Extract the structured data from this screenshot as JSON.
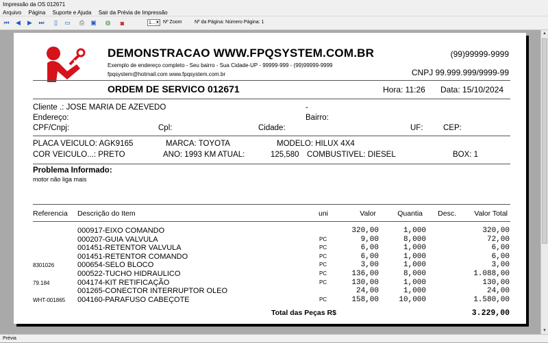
{
  "window": {
    "title": "Impressão da OS 012671"
  },
  "menu": [
    "Arquivo",
    "Página",
    "Suporte e Ajuda",
    "Sair da Prévia de Impressão"
  ],
  "toolbar": {
    "zoom_value": "1...",
    "zoom_label": "Nº Zoom",
    "page_label": "Nº da Página: Número Página: 1"
  },
  "status": {
    "text": "Prévia"
  },
  "doc": {
    "company": "DEMONSTRACAO WWW.FPQSYSTEM.COM.BR",
    "address": "Exemplo de endereço completo - Seu bairro - Sua Cidade-UP - 99999-999 - (99)99999-9999",
    "contact": "fpqsystem@hotmail.com  www.fpqsystem.com.br",
    "phone": "(99)99999-9999",
    "cnpj": "CNPJ 99.999.999/9999-99",
    "order_title": "ORDEM DE SERVICO 012671",
    "hora": "Hora: 11:26",
    "data": "Data: 15/10/2024",
    "cliente": "Cliente   .: JOSE MARIA DE AZEVEDO",
    "cliente_dash": "-",
    "endereco": "Endereço:",
    "bairro": "Bairro:",
    "cpf": "CPF/Cnpj:",
    "cpl": "Cpl:",
    "cidade": "Cidade:",
    "uf": "UF:",
    "cep": "CEP:",
    "placa": "PLACA VEICULO: AGK9165",
    "marca": "MARCA: TOYOTA",
    "modelo": "MODELO: HILUX 4X4",
    "cor": "COR VEICULO...: PRETO",
    "ano": "ANO: 1993  KM ATUAL:",
    "km": "125,580",
    "combustivel": "COMBUSTIVEL: DIESEL",
    "box": "BOX: 1",
    "problema_label": "Problema Informado:",
    "problema_text": "motor não liga mais",
    "columns": {
      "ref": "Referencia",
      "desc": "Descrição do Item",
      "uni": "uni",
      "valor": "Valor",
      "qtd": "Quantia",
      "desc_pct": "Desc.",
      "total": "Valor Total"
    },
    "items": [
      {
        "ref": "",
        "desc": "000917-EIXO COMANDO",
        "uni": "",
        "valor": "320,00",
        "qtd": "1,000",
        "total": "320,00"
      },
      {
        "ref": "",
        "desc": "000207-GUIA VALVULA",
        "uni": "PC",
        "valor": "9,00",
        "qtd": "8,000",
        "total": "72,00"
      },
      {
        "ref": "",
        "desc": "001451-RETENTOR VALVULA",
        "uni": "PC",
        "valor": "6,00",
        "qtd": "1,000",
        "total": "6,00"
      },
      {
        "ref": "",
        "desc": "001451-RETENTOR COMANDO",
        "uni": "PC",
        "valor": "6,00",
        "qtd": "1,000",
        "total": "6,00"
      },
      {
        "ref": "8301026",
        "desc": "000654-SELO BLOCO",
        "uni": "PC",
        "valor": "3,00",
        "qtd": "1,000",
        "total": "3,00"
      },
      {
        "ref": "",
        "desc": "000522-TUCHO HIDRAULICO",
        "uni": "PC",
        "valor": "136,00",
        "qtd": "8,000",
        "total": "1.088,00"
      },
      {
        "ref": "79.184",
        "desc": "004174-KIT RETIFICAÇÃO",
        "uni": "PC",
        "valor": "130,00",
        "qtd": "1,000",
        "total": "130,00"
      },
      {
        "ref": "",
        "desc": "001265-CONECTOR INTERRUPTOR OLEO",
        "uni": "",
        "valor": "24,00",
        "qtd": "1,000",
        "total": "24,00"
      },
      {
        "ref": "WHT-001865",
        "desc": "004160-PARAFUSO CABEÇOTE",
        "uni": "PC",
        "valor": "158,00",
        "qtd": "10,000",
        "total": "1.580,00"
      }
    ],
    "total_label": "Total das Peças R$",
    "total_value": "3.229,00"
  },
  "colors": {
    "logo_red": "#d6121b",
    "toolbar_blue": "#2357c6"
  }
}
